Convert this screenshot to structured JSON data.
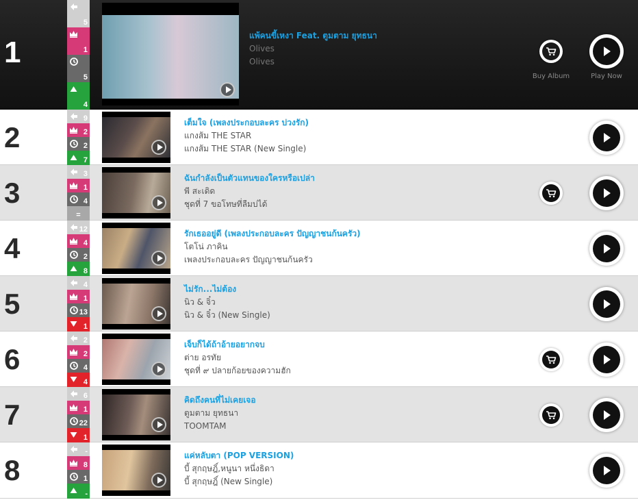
{
  "actions": {
    "buy_label": "Buy Album",
    "play_label": "Play Now"
  },
  "entries": [
    {
      "rank": "1",
      "stats": {
        "last": "5",
        "peak": "1",
        "weeks": "5",
        "move": "4",
        "trend": "up"
      },
      "title": "แพ้คนขี้เหงา Feat. ตูมตาม ยุทธนา",
      "artist": "Olives",
      "album": "Olives",
      "buy": true
    },
    {
      "rank": "2",
      "stats": {
        "last": "9",
        "peak": "2",
        "weeks": "2",
        "move": "7",
        "trend": "up"
      },
      "title": "เต็มใจ (เพลงประกอบละคร บ่วงรัก)",
      "artist": "แกงส้ม THE STAR",
      "album": "แกงส้ม THE STAR (New Single)",
      "buy": false
    },
    {
      "rank": "3",
      "stats": {
        "last": "3",
        "peak": "1",
        "weeks": "4",
        "move": "=",
        "trend": "same"
      },
      "title": "ฉันกำลังเป็นตัวแทนของใครหรือเปล่า",
      "artist": "พี สะเดิด",
      "album": "ชุดที่ 7 ขอโทษที่ลืมบ่ได้",
      "buy": true
    },
    {
      "rank": "4",
      "stats": {
        "last": "12",
        "peak": "4",
        "weeks": "2",
        "move": "8",
        "trend": "up"
      },
      "title": "รักเธออยู่ดี (เพลงประกอบละคร ปัญญาชนก้นครัว)",
      "artist": "โตโน่ ภาคิน",
      "album": "เพลงประกอบละคร ปัญญาชนก้นครัว",
      "buy": false
    },
    {
      "rank": "5",
      "stats": {
        "last": "4",
        "peak": "1",
        "weeks": "13",
        "move": "1",
        "trend": "down"
      },
      "title": "ไม่รัก...ไม่ต้อง",
      "artist": "นิว & จิ๋ว",
      "album": "นิว & จิ๋ว (New Single)",
      "buy": false
    },
    {
      "rank": "6",
      "stats": {
        "last": "2",
        "peak": "2",
        "weeks": "4",
        "move": "4",
        "trend": "down"
      },
      "title": "เจ็บก็ได้ถ้าอ้ายอยากจบ",
      "artist": "ต่าย อรทัย",
      "album": "ชุดที่ ๙ ปลายก้อยของความฮัก",
      "buy": true
    },
    {
      "rank": "7",
      "stats": {
        "last": "6",
        "peak": "1",
        "weeks": "22",
        "move": "1",
        "trend": "down"
      },
      "title": "คิดถึงคนที่ไม่เคยเจอ",
      "artist": "ตูมตาม ยุทธนา",
      "album": "TOOMTAM",
      "buy": true
    },
    {
      "rank": "8",
      "stats": {
        "last": "-",
        "peak": "8",
        "weeks": "1",
        "move": "-",
        "trend": "up"
      },
      "title": "แค่หลับตา (POP VERSION)",
      "artist": "บี้ สุกฤษฎิ์,หนูนา หนึ่งธิดา",
      "album": "บี้ สุกฤษฎิ์ (New Single)",
      "buy": false
    }
  ],
  "colors": {
    "title_link": "#1ba1e2",
    "peak": "#d63b78",
    "weeks": "#696969",
    "up": "#26a33c",
    "down": "#e3232a",
    "last_week": "#d0d0d0",
    "same": "#a8a8a8",
    "row_alt": "#e3e3e3",
    "header_bg": "#111111"
  },
  "icons": {
    "last_week": "arrow-left-icon",
    "peak": "crown-icon",
    "weeks": "clock-icon",
    "up": "triangle-up-icon",
    "down": "triangle-down-icon",
    "buy": "cart-icon",
    "play": "play-icon"
  }
}
